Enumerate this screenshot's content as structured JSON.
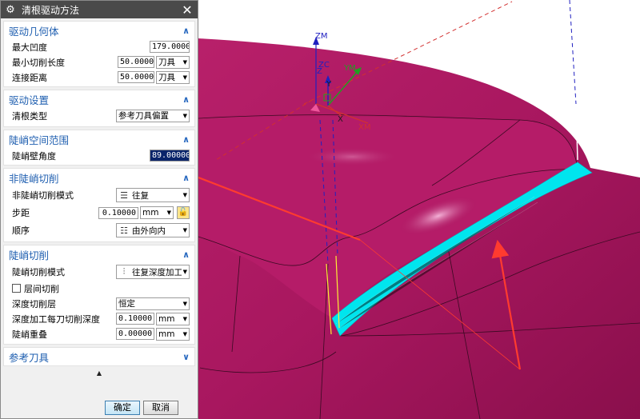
{
  "dialog": {
    "title": "清根驱动方法",
    "icon": "gear-icon",
    "close_icon": "close-icon"
  },
  "sections": {
    "drive_geometry": {
      "title": "驱动几何体",
      "max_concavity_label": "最大凹度",
      "max_concavity_value": "179.0000",
      "min_cut_length_label": "最小切削长度",
      "min_cut_length_value": "50.00000",
      "min_cut_length_unit": "刀具",
      "connect_distance_label": "连接距离",
      "connect_distance_value": "50.00000",
      "connect_distance_unit": "刀具"
    },
    "drive_settings": {
      "title": "驱动设置",
      "cleanup_type_label": "清根类型",
      "cleanup_type_value": "参考刀具偏置"
    },
    "steep_range": {
      "title": "陡峭空间范围",
      "steep_angle_label": "陡峭壁角度",
      "steep_angle_value": "89.00000"
    },
    "non_steep": {
      "title": "非陡峭切削",
      "pattern_label": "非陡峭切削模式",
      "pattern_value": "往复",
      "stepover_label": "步距",
      "stepover_value": "0.10000",
      "stepover_unit": "mm",
      "order_label": "顺序",
      "order_value": "由外向内"
    },
    "steep": {
      "title": "陡峭切削",
      "pattern_label": "陡峭切削模式",
      "pattern_value": "往复深度加工",
      "layer_cut_label": "层间切削",
      "depth_layer_label": "深度切削层",
      "depth_layer_value": "恒定",
      "depth_per_cut_label": "深度加工每刀切削深度",
      "depth_per_cut_value": "0.10000",
      "depth_per_cut_unit": "mm",
      "steep_overlap_label": "陡峭重叠",
      "steep_overlap_value": "0.00000",
      "steep_overlap_unit": "mm"
    },
    "ref_tool": {
      "title": "参考刀具"
    }
  },
  "footer": {
    "ok_label": "确定",
    "cancel_label": "取消"
  },
  "viewport": {
    "axis_zm": "ZM",
    "axis_xm": "XM",
    "axis_ym": "YM",
    "axis_zc": "ZC",
    "axis_x": "X",
    "axis_y": "Y",
    "axis_z": "Z",
    "surface_color": "#a8175f",
    "highlight_color": "#00e5ee",
    "arrow_color": "#ff3b2f"
  }
}
